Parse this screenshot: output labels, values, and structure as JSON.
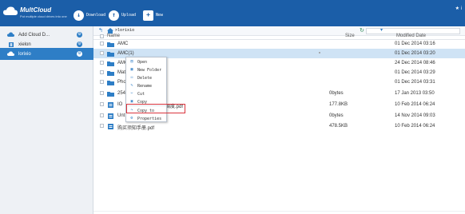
{
  "app": {
    "logo_title": "MultCloud",
    "logo_subtitle": "Put multiple cloud drives into one",
    "user_glyph": "★ i"
  },
  "toolbar": {
    "download_label": "Download",
    "upload_label": "Upload",
    "new_label": "New"
  },
  "sidebar": {
    "items": [
      {
        "label": "Add Cloud D...",
        "icon": "cloud-plus-icon",
        "active": false
      },
      {
        "label": "xielon",
        "icon": "dropbox-icon",
        "active": false
      },
      {
        "label": "lorixio",
        "icon": "cloud-icon",
        "active": true
      }
    ]
  },
  "path": {
    "crumb": "lorixio"
  },
  "list": {
    "headers": {
      "name": "Name",
      "size": "Size",
      "modified": "Modified Date"
    },
    "rows": [
      {
        "name": "AMC",
        "size": "",
        "date": "01 Dec 2014 03:16",
        "type": "folder"
      },
      {
        "name": "AMC(1)",
        "size": "",
        "date": "01 Dec 2014 03:20",
        "type": "folder",
        "selected": true
      },
      {
        "name": "AMC",
        "size": "",
        "date": "24 Dec 2014 08:46",
        "type": "folder"
      },
      {
        "name": "Mat",
        "size": "",
        "date": "01 Dec 2014 03:29",
        "type": "folder"
      },
      {
        "name": "Pho",
        "size": "",
        "date": "01 Dec 2014 03:31",
        "type": "folder"
      },
      {
        "name": "254",
        "size": "0bytes",
        "date": "17 Jan 2013 03:50",
        "type": "folder"
      },
      {
        "name": "IO",
        "suffix": "调度.pdf",
        "size": "177.8KB",
        "date": "10 Feb 2014 06:24",
        "type": "pdf"
      },
      {
        "name": "Unt",
        "size": "0bytes",
        "date": "14 Nov 2014 09:03",
        "type": "doc"
      },
      {
        "name": "购买须知手册.pdf",
        "size": "478.5KB",
        "date": "10 Feb 2014 06:24",
        "type": "pdf"
      }
    ]
  },
  "context_menu": {
    "items": [
      {
        "label": "Open",
        "icon": "open-icon"
      },
      {
        "label": "New Folder",
        "icon": "new-folder-icon"
      },
      {
        "label": "Delete",
        "icon": "delete-icon"
      },
      {
        "label": "Rename",
        "icon": "rename-icon"
      },
      {
        "label": "Cut",
        "icon": "cut-icon"
      },
      {
        "label": "Copy",
        "icon": "copy-icon"
      },
      {
        "label": "Copy to",
        "icon": "copy-to-icon"
      },
      {
        "label": "Properties",
        "icon": "properties-icon"
      }
    ]
  },
  "colors": {
    "topbar": "#1b5ea8",
    "accent": "#2e7ec6",
    "selected_row": "#cfe3f5",
    "highlight": "#d9343d"
  }
}
